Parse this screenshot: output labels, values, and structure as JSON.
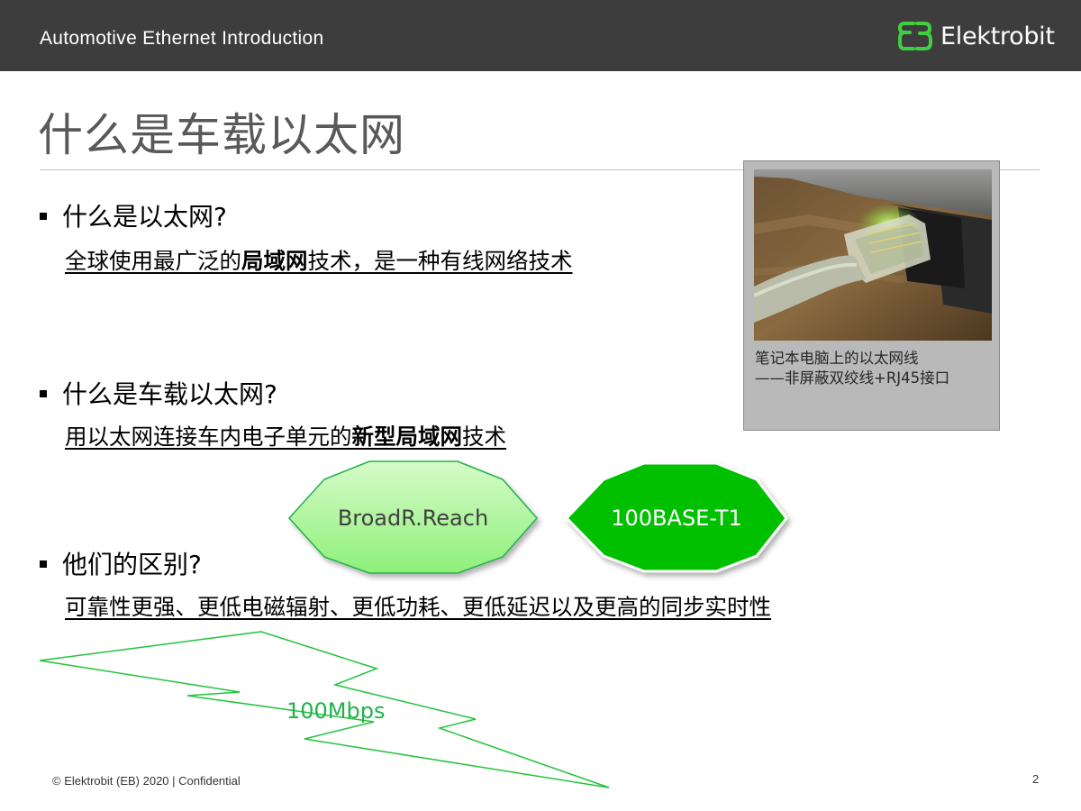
{
  "header": {
    "title": "Automotive Ethernet Introduction",
    "logo_text": "Elektrobit",
    "logo_icon": "eb-logo-icon",
    "accent_color": "#3fcf3f"
  },
  "slide": {
    "title": "什么是车载以太网",
    "q1": "什么是以太网?",
    "a1_pre": "全球使用最广泛的",
    "a1_bold": "局域网",
    "a1_post": "技术，是一种有线网络技术",
    "q2": "什么是车载以太网?",
    "a2_pre": "用以太网连接车内电子单元的",
    "a2_bold": "新型局域网",
    "a2_post": "技术",
    "q3": "他们的区别?",
    "a3": "可靠性更强、更低电磁辐射、更低功耗、更低延迟以及更高的同步实时性"
  },
  "photo": {
    "caption_line1": "笔记本电脑上的以太网线",
    "caption_line2": "——非屏蔽双绞线+RJ45接口"
  },
  "shapes": {
    "broadr": "BroadR.Reach",
    "base_t1": "100BASE-T1",
    "bolt_label": "100Mbps",
    "green_dark": "#00c000",
    "green_light": "#b8f5a8"
  },
  "footer": {
    "copyright": "© Elektrobit (EB) 2020 | Confidential",
    "page_number": "2"
  }
}
